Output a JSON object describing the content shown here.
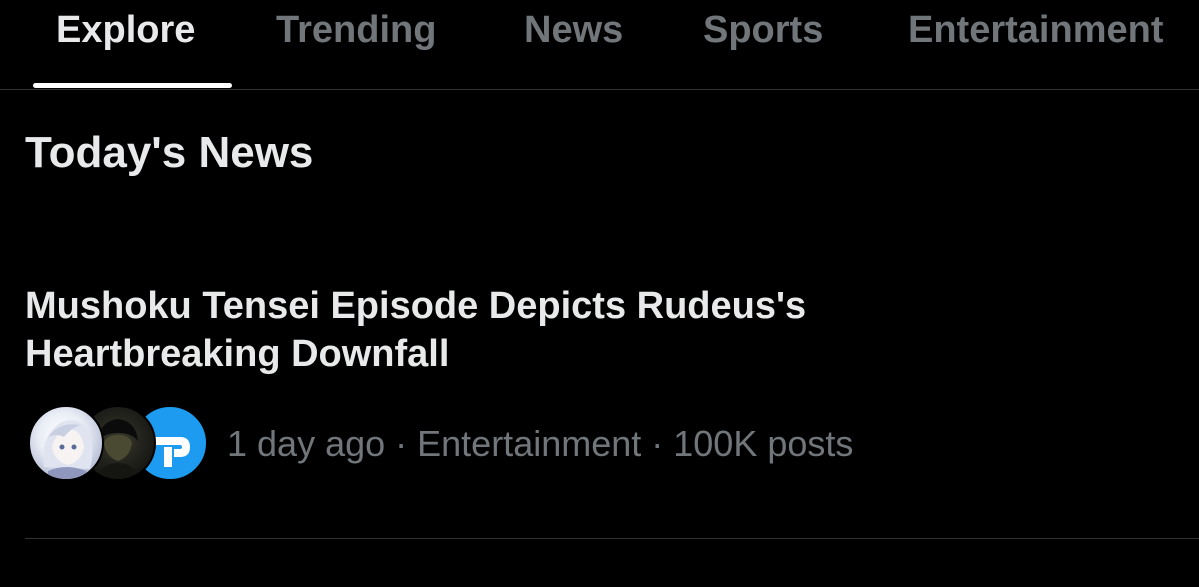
{
  "tabs": [
    {
      "label": "Explore",
      "active": true
    },
    {
      "label": "Trending",
      "active": false
    },
    {
      "label": "News",
      "active": false
    },
    {
      "label": "Sports",
      "active": false
    },
    {
      "label": "Entertainment",
      "active": false
    }
  ],
  "section": {
    "title": "Today's News"
  },
  "news_item": {
    "headline": "Mushoku Tensei Episode Depicts Rudeus's Heartbreaking Downfall",
    "time": "1 day ago",
    "category": "Entertainment",
    "posts": "100K posts",
    "separator": " · ",
    "avatars": [
      "anime-character-avatar",
      "dark-character-avatar",
      "brand-logo-avatar"
    ]
  },
  "colors": {
    "background": "#000000",
    "primary_text": "#e7e9ea",
    "secondary_text": "#71767b",
    "divider": "#2f3336",
    "indicator": "#ffffff",
    "brand_avatar": "#1d9bf0"
  }
}
